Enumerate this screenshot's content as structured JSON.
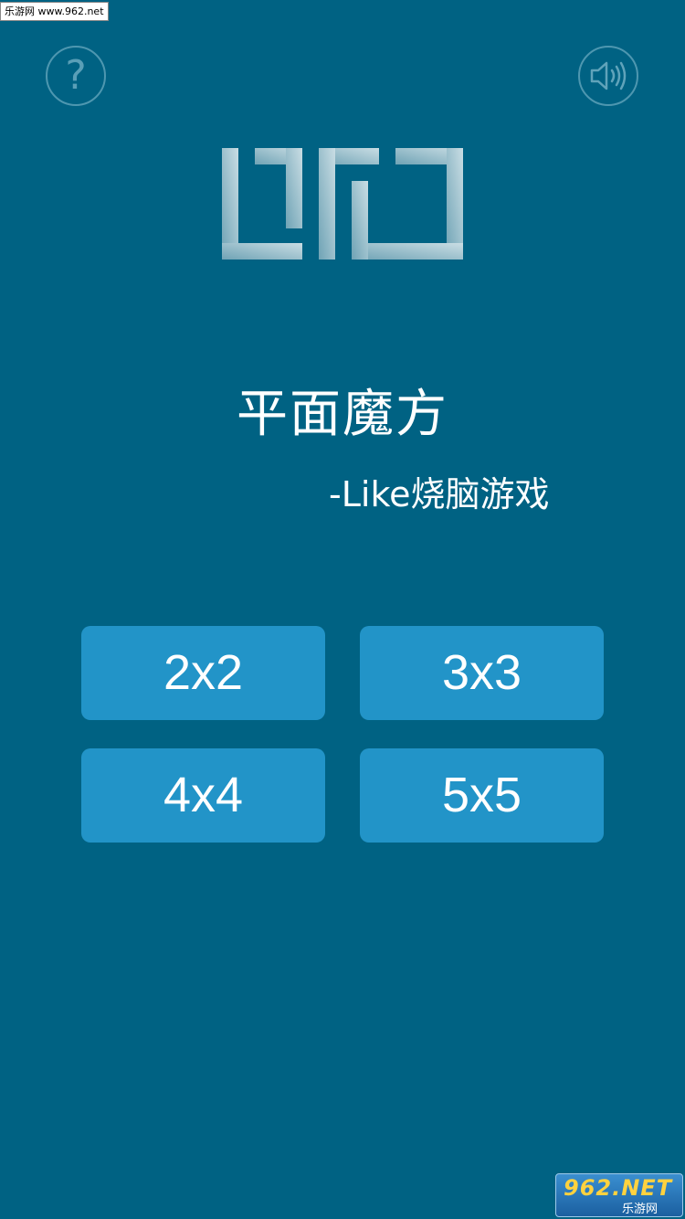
{
  "watermark": {
    "top_text": "乐游网 www.962.net",
    "bottom_brand": "962.NET",
    "bottom_sub": "乐游网"
  },
  "header": {
    "help_icon": "question-mark-icon",
    "help_glyph": "?",
    "sound_icon": "speaker-icon"
  },
  "logo": {
    "icon": "game-logo-bracket-shapes"
  },
  "title": "平面魔方",
  "subtitle": "-Like烧脑游戏",
  "modes": [
    {
      "label": "2x2"
    },
    {
      "label": "3x3"
    },
    {
      "label": "4x4"
    },
    {
      "label": "5x5"
    }
  ],
  "colors": {
    "background": "#006283",
    "button": "#2294c8",
    "icon_outline": "#78b4c8"
  }
}
